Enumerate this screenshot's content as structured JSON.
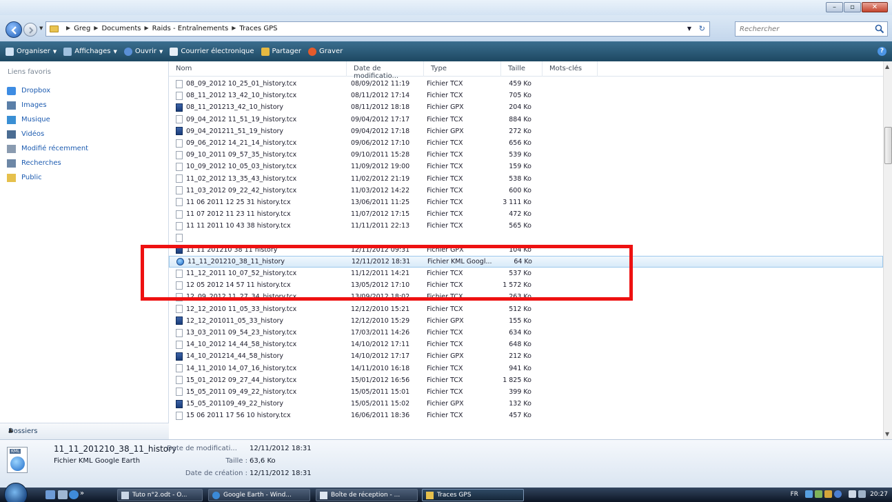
{
  "window": {
    "minimize_label": "–",
    "maximize_label": "▫",
    "close_label": "✕"
  },
  "address": {
    "breadcrumbs": [
      "Greg",
      "Documents",
      "Raids - Entraînements",
      "Traces GPS"
    ],
    "search_placeholder": "Rechercher"
  },
  "toolbar": {
    "organize": "Organiser",
    "views": "Affichages",
    "open": "Ouvrir",
    "email": "Courrier électronique",
    "share": "Partager",
    "burn": "Graver"
  },
  "navpane": {
    "title": "Liens favoris",
    "items": [
      {
        "label": "Dropbox",
        "icon": "dropbox-icon"
      },
      {
        "label": "Images",
        "icon": "images-icon"
      },
      {
        "label": "Musique",
        "icon": "music-icon"
      },
      {
        "label": "Vidéos",
        "icon": "videos-icon"
      },
      {
        "label": "Modifié récemment",
        "icon": "recent-icon"
      },
      {
        "label": "Recherches",
        "icon": "search-folder-icon"
      },
      {
        "label": "Public",
        "icon": "public-folder-icon"
      }
    ],
    "folders_label": "Dossiers"
  },
  "columns": {
    "name": "Nom",
    "date": "Date de modificatio...",
    "type": "Type",
    "size": "Taille",
    "keywords": "Mots-clés"
  },
  "files": [
    {
      "name": "08_09_2012 10_25_01_history.tcx",
      "date": "08/09/2012 11:19",
      "type": "Fichier TCX",
      "size": "459 Ko",
      "kind": "tcx"
    },
    {
      "name": "08_11_2012 13_42_10_history.tcx",
      "date": "08/11/2012 17:14",
      "type": "Fichier TCX",
      "size": "705 Ko",
      "kind": "tcx"
    },
    {
      "name": "08_11_201213_42_10_history",
      "date": "08/11/2012 18:18",
      "type": "Fichier GPX",
      "size": "204 Ko",
      "kind": "gpx"
    },
    {
      "name": "09_04_2012 11_51_19_history.tcx",
      "date": "09/04/2012 17:17",
      "type": "Fichier TCX",
      "size": "884 Ko",
      "kind": "tcx"
    },
    {
      "name": "09_04_201211_51_19_history",
      "date": "09/04/2012 17:18",
      "type": "Fichier GPX",
      "size": "272 Ko",
      "kind": "gpx"
    },
    {
      "name": "09_06_2012 14_21_14_history.tcx",
      "date": "09/06/2012 17:10",
      "type": "Fichier TCX",
      "size": "656 Ko",
      "kind": "tcx"
    },
    {
      "name": "09_10_2011 09_57_35_history.tcx",
      "date": "09/10/2011 15:28",
      "type": "Fichier TCX",
      "size": "539 Ko",
      "kind": "tcx"
    },
    {
      "name": "10_09_2012 10_05_03_history.tcx",
      "date": "11/09/2012 19:00",
      "type": "Fichier TCX",
      "size": "159 Ko",
      "kind": "tcx"
    },
    {
      "name": "11_02_2012 13_35_43_history.tcx",
      "date": "11/02/2012 21:19",
      "type": "Fichier TCX",
      "size": "538 Ko",
      "kind": "tcx"
    },
    {
      "name": "11_03_2012 09_22_42_history.tcx",
      "date": "11/03/2012 14:22",
      "type": "Fichier TCX",
      "size": "600 Ko",
      "kind": "tcx"
    },
    {
      "name": "11 06 2011 12 25 31 history.tcx",
      "date": "13/06/2011 11:25",
      "type": "Fichier TCX",
      "size": "3 111 Ko",
      "kind": "tcx"
    },
    {
      "name": "11 07 2012 11 23 11 history.tcx",
      "date": "11/07/2012 17:15",
      "type": "Fichier TCX",
      "size": "472 Ko",
      "kind": "tcx"
    },
    {
      "name": "11 11 2011 10 43 38 history.tcx",
      "date": "11/11/2011 22:13",
      "type": "Fichier TCX",
      "size": "565 Ko",
      "kind": "tcx"
    },
    {
      "name": "",
      "date": "",
      "type": "",
      "size": "",
      "kind": "tcx"
    },
    {
      "name": "11 11 201210 38 11 history",
      "date": "12/11/2012 09:31",
      "type": "Fichier GPX",
      "size": "104 Ko",
      "kind": "gpx"
    },
    {
      "name": "11_11_201210_38_11_history",
      "date": "12/11/2012 18:31",
      "type": "Fichier KML Googl...",
      "size": "64 Ko",
      "kind": "kml",
      "selected": true
    },
    {
      "name": "11_12_2011 10_07_52_history.tcx",
      "date": "11/12/2011 14:21",
      "type": "Fichier TCX",
      "size": "537 Ko",
      "kind": "tcx"
    },
    {
      "name": "12 05 2012 14 57 11 history.tcx",
      "date": "13/05/2012 17:10",
      "type": "Fichier TCX",
      "size": "1 572 Ko",
      "kind": "tcx"
    },
    {
      "name": "12_09_2012 11_27_34_history.tcx",
      "date": "13/09/2012 18:02",
      "type": "Fichier TCX",
      "size": "263 Ko",
      "kind": "tcx"
    },
    {
      "name": "12_12_2010 11_05_33_history.tcx",
      "date": "12/12/2010 15:21",
      "type": "Fichier TCX",
      "size": "512 Ko",
      "kind": "tcx"
    },
    {
      "name": "12_12_201011_05_33_history",
      "date": "12/12/2010 15:29",
      "type": "Fichier GPX",
      "size": "155 Ko",
      "kind": "gpx"
    },
    {
      "name": "13_03_2011 09_54_23_history.tcx",
      "date": "17/03/2011 14:26",
      "type": "Fichier TCX",
      "size": "634 Ko",
      "kind": "tcx"
    },
    {
      "name": "14_10_2012 14_44_58_history.tcx",
      "date": "14/10/2012 17:11",
      "type": "Fichier TCX",
      "size": "648 Ko",
      "kind": "tcx"
    },
    {
      "name": "14_10_201214_44_58_history",
      "date": "14/10/2012 17:17",
      "type": "Fichier GPX",
      "size": "212 Ko",
      "kind": "gpx"
    },
    {
      "name": "14_11_2010 14_07_16_history.tcx",
      "date": "14/11/2010 16:18",
      "type": "Fichier TCX",
      "size": "941 Ko",
      "kind": "tcx"
    },
    {
      "name": "15_01_2012 09_27_44_history.tcx",
      "date": "15/01/2012 16:56",
      "type": "Fichier TCX",
      "size": "1 825 Ko",
      "kind": "tcx"
    },
    {
      "name": "15_05_2011 09_49_22_history.tcx",
      "date": "15/05/2011 15:01",
      "type": "Fichier TCX",
      "size": "399 Ko",
      "kind": "tcx"
    },
    {
      "name": "15_05_201109_49_22_history",
      "date": "15/05/2011 15:02",
      "type": "Fichier GPX",
      "size": "132 Ko",
      "kind": "gpx"
    },
    {
      "name": "15 06 2011 17 56 10 history.tcx",
      "date": "16/06/2011 18:36",
      "type": "Fichier TCX",
      "size": "457 Ko",
      "kind": "tcx"
    }
  ],
  "details": {
    "name": "11_11_201210_38_11_history",
    "type": "Fichier KML Google Earth",
    "modified_label": "Date de modificati...",
    "modified_value": "12/11/2012 18:31",
    "size_label": "Taille :",
    "size_value": "63,6 Ko",
    "created_label": "Date de création :",
    "created_value": "12/11/2012 18:31"
  },
  "taskbar": {
    "chevron": "»",
    "buttons": [
      {
        "label": "Tuto n°2.odt - O...",
        "icon": "document-icon"
      },
      {
        "label": "Google Earth - Wind...",
        "icon": "google-earth-icon"
      },
      {
        "label": "Boîte de réception - ...",
        "icon": "mail-icon"
      },
      {
        "label": "Traces GPS",
        "icon": "folder-icon",
        "active": true
      }
    ],
    "language": "FR",
    "clock": "20:27"
  },
  "colors": {
    "command_bar": "#1d4862",
    "highlight": "#ee1111",
    "link": "#1c5bb0"
  }
}
